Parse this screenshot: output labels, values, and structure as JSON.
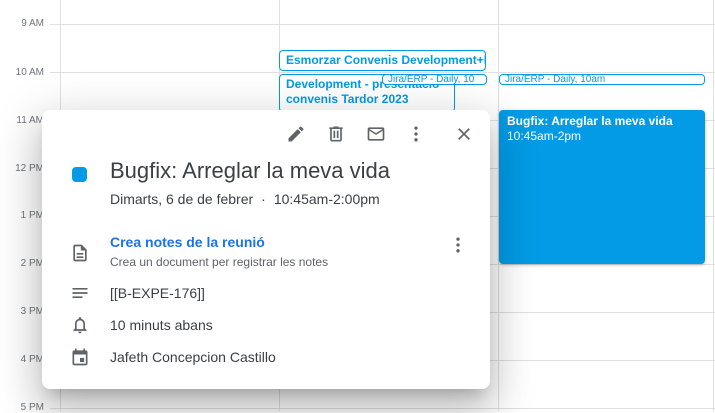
{
  "calendar": {
    "hours": [
      "9 AM",
      "10 AM",
      "11 AM",
      "12 PM",
      "1 PM",
      "2 PM",
      "3 PM",
      "4 PM",
      "5 PM"
    ],
    "events": {
      "esmorzar": "Esmorzar Convenis Development+EN",
      "development": "Development - presentació convenis Tardor 2023",
      "jira_col2": {
        "title": "Jira/ERP - Daily,",
        "time": "10"
      },
      "jira_col3": {
        "title": "Jira/ERP - Daily,",
        "time": "10am"
      },
      "bugfix": {
        "title": "Bugfix: Arreglar la meva vida",
        "time": "10:45am-2pm"
      }
    },
    "accent_color": "#039be5"
  },
  "popup": {
    "title": "Bugfix: Arreglar la meva vida",
    "date": "Dimarts, 6 de de febrer",
    "separator": "·",
    "time": "10:45am-2:00pm",
    "notes_link": "Crea notes de la reunió",
    "notes_sub": "Crea un document per registrar les notes",
    "description": "[[B-EXPE-176]]",
    "reminder": "10 minuts abans",
    "organizer": "Jafeth Concepcion Castillo",
    "icons": [
      "edit-icon",
      "delete-icon",
      "email-icon",
      "more-vert-icon",
      "close-icon",
      "document-icon",
      "description-icon",
      "bell-icon",
      "calendar-icon"
    ]
  }
}
